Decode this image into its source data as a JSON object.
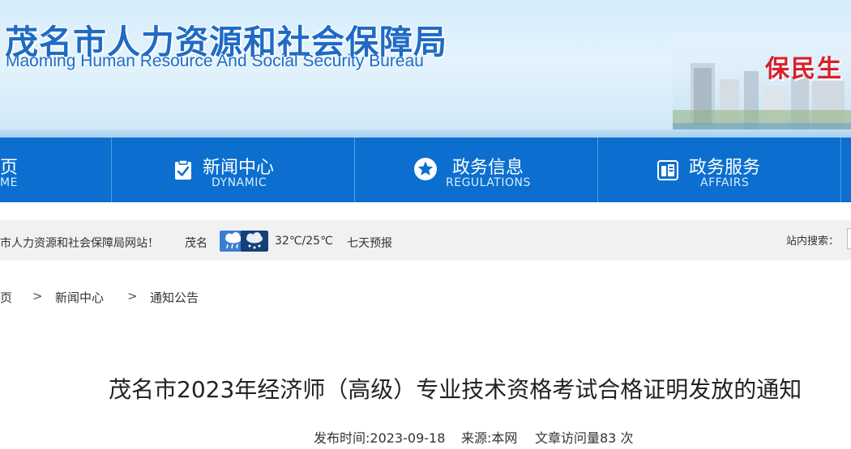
{
  "header": {
    "title": "茂名市人力资源和社会保障局",
    "subtitle": "Maoming Human Resource And Social Security Bureau",
    "slogan": "保民生"
  },
  "nav": {
    "items": [
      {
        "zh": "页",
        "en": "ME",
        "icon": ""
      },
      {
        "zh": "新闻中心",
        "en": "DYNAMIC",
        "icon": "clipboard-check-icon"
      },
      {
        "zh": "政务信息",
        "en": "REGULATIONS",
        "icon": "star-icon"
      },
      {
        "zh": "政务服务",
        "en": "AFFAIRS",
        "icon": "service-icon"
      }
    ]
  },
  "infobar": {
    "welcome": "市人力资源和社会保障局网站！",
    "city": "茂名",
    "weather_icons": [
      "rain-cloud-icon",
      "snow-cloud-icon"
    ],
    "temperature": "32℃/25℃",
    "forecast_link": "七天预报",
    "search_label": "站内搜索："
  },
  "breadcrumb": [
    "页",
    "新闻中心",
    "通知公告"
  ],
  "breadcrumb_separator": ">",
  "article": {
    "title": "茂名市2023年经济师（高级）专业技术资格考试合格证明发放的通知",
    "publish_label": "发布时间:2023-09-18",
    "source_label": "来源:本网",
    "visits_label": "文章访问量83 次"
  },
  "colors": {
    "nav_blue": "#0c6fcf",
    "title_blue": "#1f6bc4",
    "slogan_red": "#d8202c",
    "infobar_bg": "#f1f1f1"
  }
}
